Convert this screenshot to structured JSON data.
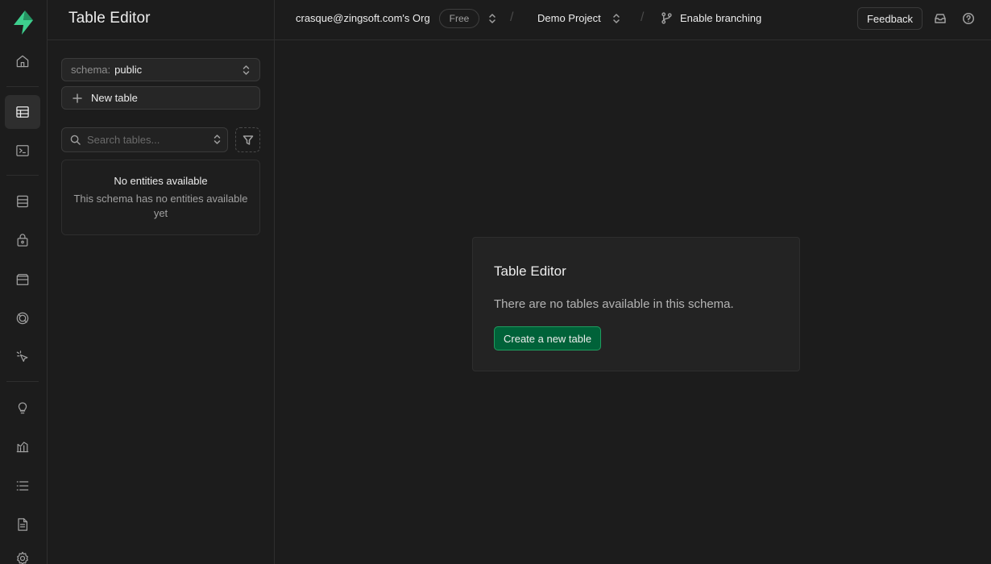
{
  "sidebar": {
    "title": "Table Editor",
    "schema_label": "schema:",
    "schema_value": "public",
    "new_table_label": "New table",
    "search_placeholder": "Search tables...",
    "empty_title": "No entities available",
    "empty_desc": "This schema has no entities available yet"
  },
  "topbar": {
    "org": "crasque@zingsoft.com's Org",
    "plan_badge": "Free",
    "separator": "/",
    "project": "Demo Project",
    "branching": "Enable branching",
    "feedback": "Feedback"
  },
  "main": {
    "card_title": "Table Editor",
    "card_desc": "There are no tables available in this schema.",
    "card_button": "Create a new table"
  },
  "rail_icons": [
    "home-icon",
    "table-editor-icon",
    "sql-editor-icon",
    "database-icon",
    "auth-icon",
    "storage-icon",
    "realtime-icon",
    "edge-functions-icon",
    "advisors-icon",
    "reports-icon",
    "logs-icon",
    "api-docs-icon",
    "settings-icon"
  ],
  "colors": {
    "brand": "#3ecf8e",
    "primary_button": "#006239",
    "background": "#1c1c1c"
  }
}
